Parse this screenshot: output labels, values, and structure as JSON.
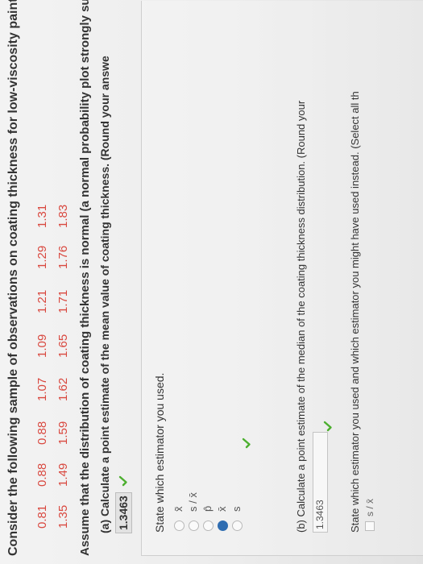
{
  "question": {
    "text": "Consider the following sample of observations on coating thickness for low-viscosity paint."
  },
  "sample": {
    "row1": [
      "0.81",
      "0.88",
      "0.88",
      "1.07",
      "1.09",
      "1.21",
      "1.29",
      "1.31"
    ],
    "row2": [
      "1.35",
      "1.49",
      "1.59",
      "1.62",
      "1.65",
      "1.71",
      "1.76",
      "1.83"
    ]
  },
  "assumption": {
    "text": "Assume that the distribution of coating thickness is normal (a normal probability plot strongly sup"
  },
  "part_a": {
    "question": "(a) Calculate a point estimate of the mean value of coating thickness. (Round your answe",
    "answer": "1.3463",
    "prompt": "State which estimator you used.",
    "options": [
      "x̃",
      "s / x̄",
      "p̂",
      "x̄",
      "s"
    ],
    "selected_index": 3
  },
  "part_b": {
    "question": "(b) Calculate a point estimate of the median of the coating thickness distribution. (Round your",
    "answer": "1.3463",
    "prompt": "State which estimator you used and which estimator you might have used instead. (Select all th",
    "option_partial": "s / x̄"
  },
  "colors": {
    "sample_text": "#d9483f",
    "check_green": "#4caf2f",
    "selected_radio": "#2f6db1"
  }
}
